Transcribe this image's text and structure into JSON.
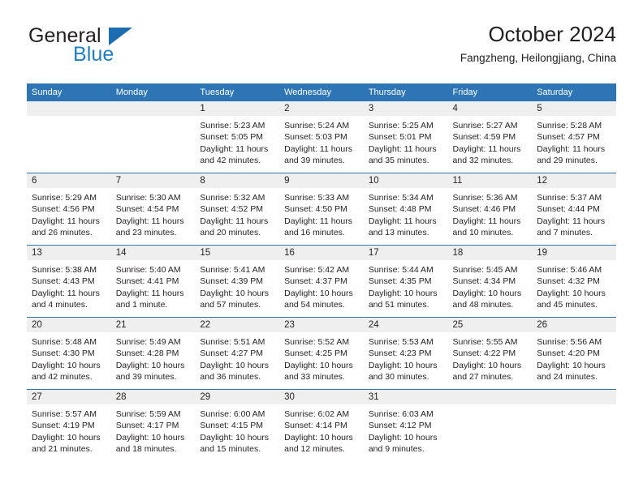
{
  "brand": {
    "line1": "General",
    "line2": "Blue",
    "triangle_icon": "brand-triangle-icon",
    "colors": {
      "dark": "#231f20",
      "blue": "#1f7fc4",
      "triangle": "#1b6cb0"
    }
  },
  "header": {
    "title": "October 2024",
    "subtitle": "Fangzheng, Heilongjiang, China"
  },
  "calendar": {
    "accent_color": "#2e75b6",
    "daynum_band_color": "#efefef",
    "weekday_headers": [
      "Sunday",
      "Monday",
      "Tuesday",
      "Wednesday",
      "Thursday",
      "Friday",
      "Saturday"
    ],
    "weeks": [
      [
        {
          "day": "",
          "sunrise": "",
          "sunset": "",
          "daylight": ""
        },
        {
          "day": "",
          "sunrise": "",
          "sunset": "",
          "daylight": ""
        },
        {
          "day": "1",
          "sunrise": "Sunrise: 5:23 AM",
          "sunset": "Sunset: 5:05 PM",
          "daylight": "Daylight: 11 hours and 42 minutes."
        },
        {
          "day": "2",
          "sunrise": "Sunrise: 5:24 AM",
          "sunset": "Sunset: 5:03 PM",
          "daylight": "Daylight: 11 hours and 39 minutes."
        },
        {
          "day": "3",
          "sunrise": "Sunrise: 5:25 AM",
          "sunset": "Sunset: 5:01 PM",
          "daylight": "Daylight: 11 hours and 35 minutes."
        },
        {
          "day": "4",
          "sunrise": "Sunrise: 5:27 AM",
          "sunset": "Sunset: 4:59 PM",
          "daylight": "Daylight: 11 hours and 32 minutes."
        },
        {
          "day": "5",
          "sunrise": "Sunrise: 5:28 AM",
          "sunset": "Sunset: 4:57 PM",
          "daylight": "Daylight: 11 hours and 29 minutes."
        }
      ],
      [
        {
          "day": "6",
          "sunrise": "Sunrise: 5:29 AM",
          "sunset": "Sunset: 4:56 PM",
          "daylight": "Daylight: 11 hours and 26 minutes."
        },
        {
          "day": "7",
          "sunrise": "Sunrise: 5:30 AM",
          "sunset": "Sunset: 4:54 PM",
          "daylight": "Daylight: 11 hours and 23 minutes."
        },
        {
          "day": "8",
          "sunrise": "Sunrise: 5:32 AM",
          "sunset": "Sunset: 4:52 PM",
          "daylight": "Daylight: 11 hours and 20 minutes."
        },
        {
          "day": "9",
          "sunrise": "Sunrise: 5:33 AM",
          "sunset": "Sunset: 4:50 PM",
          "daylight": "Daylight: 11 hours and 16 minutes."
        },
        {
          "day": "10",
          "sunrise": "Sunrise: 5:34 AM",
          "sunset": "Sunset: 4:48 PM",
          "daylight": "Daylight: 11 hours and 13 minutes."
        },
        {
          "day": "11",
          "sunrise": "Sunrise: 5:36 AM",
          "sunset": "Sunset: 4:46 PM",
          "daylight": "Daylight: 11 hours and 10 minutes."
        },
        {
          "day": "12",
          "sunrise": "Sunrise: 5:37 AM",
          "sunset": "Sunset: 4:44 PM",
          "daylight": "Daylight: 11 hours and 7 minutes."
        }
      ],
      [
        {
          "day": "13",
          "sunrise": "Sunrise: 5:38 AM",
          "sunset": "Sunset: 4:43 PM",
          "daylight": "Daylight: 11 hours and 4 minutes."
        },
        {
          "day": "14",
          "sunrise": "Sunrise: 5:40 AM",
          "sunset": "Sunset: 4:41 PM",
          "daylight": "Daylight: 11 hours and 1 minute."
        },
        {
          "day": "15",
          "sunrise": "Sunrise: 5:41 AM",
          "sunset": "Sunset: 4:39 PM",
          "daylight": "Daylight: 10 hours and 57 minutes."
        },
        {
          "day": "16",
          "sunrise": "Sunrise: 5:42 AM",
          "sunset": "Sunset: 4:37 PM",
          "daylight": "Daylight: 10 hours and 54 minutes."
        },
        {
          "day": "17",
          "sunrise": "Sunrise: 5:44 AM",
          "sunset": "Sunset: 4:35 PM",
          "daylight": "Daylight: 10 hours and 51 minutes."
        },
        {
          "day": "18",
          "sunrise": "Sunrise: 5:45 AM",
          "sunset": "Sunset: 4:34 PM",
          "daylight": "Daylight: 10 hours and 48 minutes."
        },
        {
          "day": "19",
          "sunrise": "Sunrise: 5:46 AM",
          "sunset": "Sunset: 4:32 PM",
          "daylight": "Daylight: 10 hours and 45 minutes."
        }
      ],
      [
        {
          "day": "20",
          "sunrise": "Sunrise: 5:48 AM",
          "sunset": "Sunset: 4:30 PM",
          "daylight": "Daylight: 10 hours and 42 minutes."
        },
        {
          "day": "21",
          "sunrise": "Sunrise: 5:49 AM",
          "sunset": "Sunset: 4:28 PM",
          "daylight": "Daylight: 10 hours and 39 minutes."
        },
        {
          "day": "22",
          "sunrise": "Sunrise: 5:51 AM",
          "sunset": "Sunset: 4:27 PM",
          "daylight": "Daylight: 10 hours and 36 minutes."
        },
        {
          "day": "23",
          "sunrise": "Sunrise: 5:52 AM",
          "sunset": "Sunset: 4:25 PM",
          "daylight": "Daylight: 10 hours and 33 minutes."
        },
        {
          "day": "24",
          "sunrise": "Sunrise: 5:53 AM",
          "sunset": "Sunset: 4:23 PM",
          "daylight": "Daylight: 10 hours and 30 minutes."
        },
        {
          "day": "25",
          "sunrise": "Sunrise: 5:55 AM",
          "sunset": "Sunset: 4:22 PM",
          "daylight": "Daylight: 10 hours and 27 minutes."
        },
        {
          "day": "26",
          "sunrise": "Sunrise: 5:56 AM",
          "sunset": "Sunset: 4:20 PM",
          "daylight": "Daylight: 10 hours and 24 minutes."
        }
      ],
      [
        {
          "day": "27",
          "sunrise": "Sunrise: 5:57 AM",
          "sunset": "Sunset: 4:19 PM",
          "daylight": "Daylight: 10 hours and 21 minutes."
        },
        {
          "day": "28",
          "sunrise": "Sunrise: 5:59 AM",
          "sunset": "Sunset: 4:17 PM",
          "daylight": "Daylight: 10 hours and 18 minutes."
        },
        {
          "day": "29",
          "sunrise": "Sunrise: 6:00 AM",
          "sunset": "Sunset: 4:15 PM",
          "daylight": "Daylight: 10 hours and 15 minutes."
        },
        {
          "day": "30",
          "sunrise": "Sunrise: 6:02 AM",
          "sunset": "Sunset: 4:14 PM",
          "daylight": "Daylight: 10 hours and 12 minutes."
        },
        {
          "day": "31",
          "sunrise": "Sunrise: 6:03 AM",
          "sunset": "Sunset: 4:12 PM",
          "daylight": "Daylight: 10 hours and 9 minutes."
        },
        {
          "day": "",
          "sunrise": "",
          "sunset": "",
          "daylight": ""
        },
        {
          "day": "",
          "sunrise": "",
          "sunset": "",
          "daylight": ""
        }
      ]
    ]
  }
}
